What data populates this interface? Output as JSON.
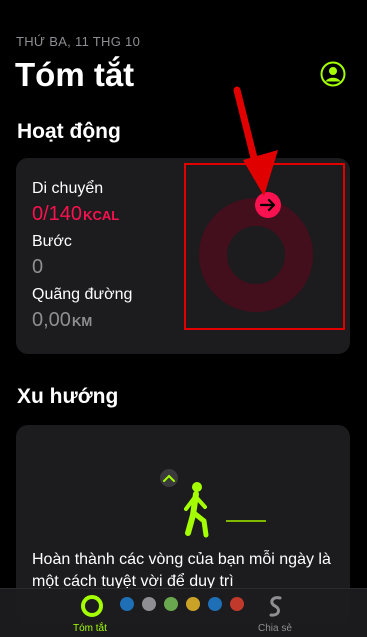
{
  "header": {
    "date": "THỨ BA, 11 THG 10",
    "title": "Tóm tắt"
  },
  "activity": {
    "section_title": "Hoạt động",
    "move_label": "Di chuyển",
    "move_value": "0/140",
    "move_unit": "KCAL",
    "steps_label": "Bước",
    "steps_value": "0",
    "distance_label": "Quãng đường",
    "distance_value": "0,00",
    "distance_unit": "KM",
    "move_progress": 0
  },
  "trends": {
    "section_title": "Xu hướng",
    "description": "Hoàn thành các vòng của bạn mỗi ngày là một cách tuyệt vời để duy trì"
  },
  "tabbar": {
    "summary_label": "Tóm tắt",
    "share_label": "Chia sẻ"
  },
  "colors": {
    "move": "#fa114f",
    "active_tab": "#a4ff00",
    "annotation": "#e00000"
  },
  "icons": [
    "profile-icon",
    "arrow-right-icon",
    "chevron-up-icon",
    "walking-figure-icon",
    "activity-ring-icon",
    "share-icon"
  ]
}
